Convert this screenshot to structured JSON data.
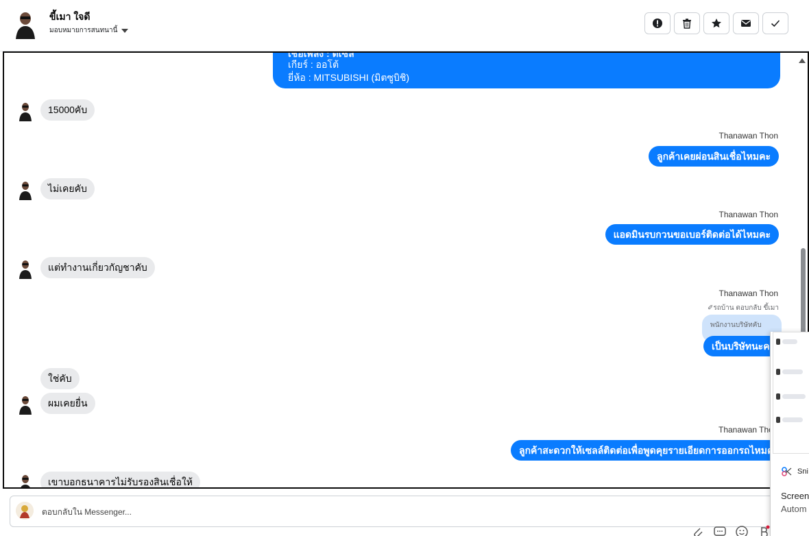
{
  "header": {
    "contact_name": "ขี้เมา ใจดี",
    "assign_label": "มอบหมายการสนทนานี้",
    "actions": [
      {
        "name": "spam-button",
        "icon": "alert-icon"
      },
      {
        "name": "delete-button",
        "icon": "trash-icon"
      },
      {
        "name": "star-button",
        "icon": "star-icon"
      },
      {
        "name": "mark-unread-button",
        "icon": "envelope-icon"
      },
      {
        "name": "done-button",
        "icon": "check-icon"
      }
    ]
  },
  "conversation": {
    "card": {
      "line_cut": "เชื้อเพลิง : ดีเซล",
      "line_gear": "เกียร์ : ออโต้",
      "line_brand": "ยี่ห้อ : MITSUBISHI (มิตซูบิชิ)"
    },
    "messages": [
      {
        "direction": "in",
        "text": "15000คับ"
      },
      {
        "direction": "out",
        "sender": "Thanawan Thon",
        "text": "ลูกค้าเคยผ่อนสินเชื่อไหมคะ"
      },
      {
        "direction": "in",
        "text": "ไม่เคยคับ"
      },
      {
        "direction": "out",
        "sender": "Thanawan Thon",
        "text": "แอดมินรบกวนขอเบอร์ติดต่อได้ไหมคะ"
      },
      {
        "direction": "in",
        "text": "แต่ทำงานเกี่ยวกัญชาคับ"
      },
      {
        "direction": "out",
        "sender": "Thanawan Thon",
        "reply_note": "รถบ้าน ตอบกลับ ขี้เมา",
        "quoted": "พนักงานบริษัทคับ",
        "text": "เป็นบริษัทนะคะ"
      },
      {
        "direction": "in",
        "text": "ใช่คับ"
      },
      {
        "direction": "in",
        "text": "ผมเคยยื่น"
      },
      {
        "direction": "out",
        "sender": "Thanawan Thon",
        "text": "ลูกค้าสะดวกให้เซลล์ติดต่อเพื่อพูดคุยรายเอียดการออกรถไหมคะ"
      },
      {
        "direction": "in",
        "text": "เขาบอกธนาคารไม่รับรองสินเชื่อให้"
      }
    ]
  },
  "composer": {
    "placeholder": "ตอบกลับใน Messenger..."
  },
  "overlay": {
    "app_name": "Sni",
    "title": "Screen",
    "subtitle": "Autom"
  },
  "colors": {
    "outgoing_bubble": "#0a7cff",
    "incoming_bubble": "#e9eaec",
    "quoted_bubble": "#cfe3fb"
  }
}
